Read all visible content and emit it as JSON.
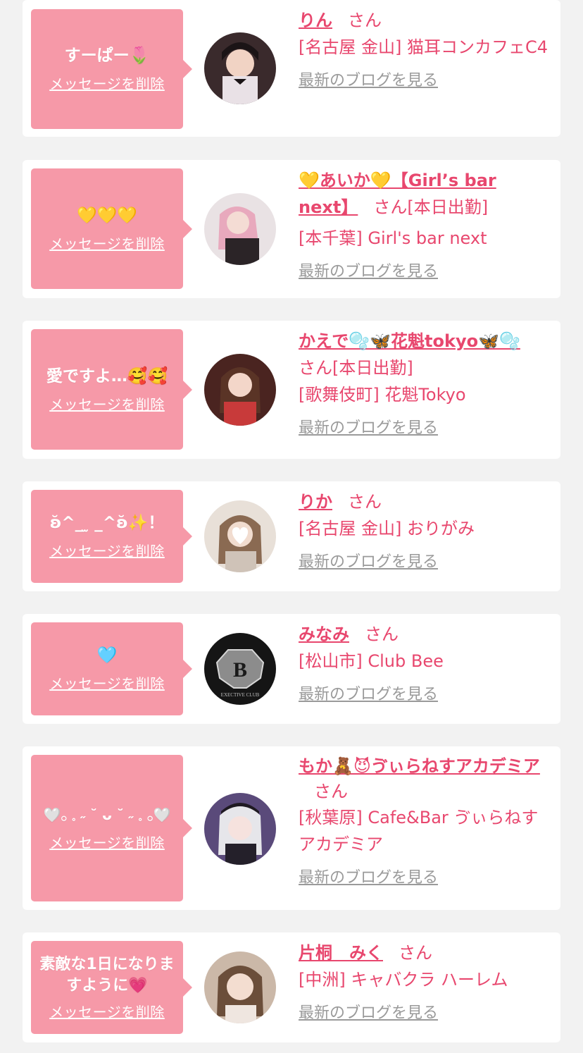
{
  "delete_label": "メッセージを削除",
  "blog_label": "最新のブログを見る",
  "honorific": "さん",
  "items": [
    {
      "message": "すーぱー🌷",
      "name": "りん",
      "status": "",
      "shop": "[名古屋 金山] 猫耳コンカフェC4"
    },
    {
      "message": "💛💛💛",
      "name": "💛あいか💛【Girl’s bar next】",
      "status": "[本日出勤]",
      "shop": "[本千葉] Girl's bar next"
    },
    {
      "message": "愛ですよ…🥰🥰",
      "name": "かえで🫧🦋花魁tokyo🦋🫧",
      "status": "[本日出勤]",
      "shop": "[歌舞伎町] 花魁Tokyo"
    },
    {
      "message": "ʚ̆^_ ̫ _^ʚ̆✨！",
      "name": "りか",
      "status": "",
      "shop": "[名古屋 金山] おりがみ"
    },
    {
      "message": "🩵",
      "name": "みなみ",
      "status": "",
      "shop": "[松山市] Club Bee"
    },
    {
      "message": "🤍𓂂 𓈒 ˶ ˘ ᴗ ˘ ˶ 𓈒 𓂂🤍",
      "name": "もか🧸😈ゔぃらねすアカデミア",
      "status": "",
      "shop": "[秋葉原] Cafe&Bar ゔぃらねすアカデミア"
    },
    {
      "message": "素敵な1日になりますように💗",
      "name": "片桐　みく",
      "status": "",
      "shop": "[中洲] キャバクラ ハーレム"
    }
  ],
  "avatar_logo_letter": "B",
  "avatar_logo_caption": "EXECTIVE CLUB",
  "colors": {
    "bubble": "#f699a8",
    "accent": "#e8476e",
    "link_gray": "#9a9a9a",
    "bg": "#f2f2f2"
  }
}
